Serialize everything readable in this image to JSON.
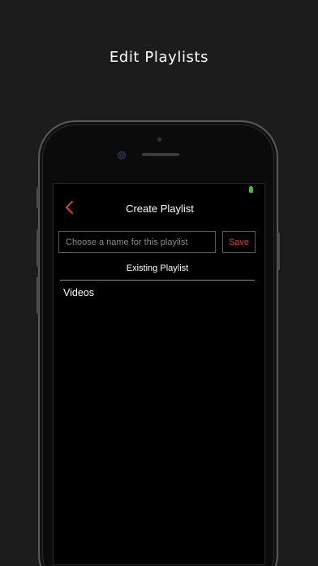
{
  "caption": "Edit Playlists",
  "nav": {
    "title": "Create Playlist",
    "back_icon": "chevron-left-icon"
  },
  "create_form": {
    "placeholder": "Choose a name for this playlist",
    "value": "",
    "save_label": "Save"
  },
  "existing": {
    "header": "Existing Playlist",
    "items": [
      "Videos"
    ]
  },
  "colors": {
    "accent": "#e33b3b",
    "battery": "#35c33a",
    "background": "#1c1c1c",
    "screen": "#000000"
  }
}
